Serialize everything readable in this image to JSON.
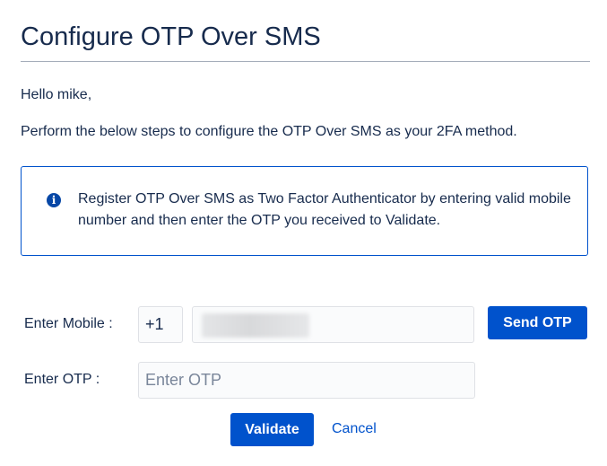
{
  "page": {
    "title": "Configure OTP Over SMS",
    "greeting": "Hello mike,",
    "instructions": "Perform the below steps to configure the OTP Over SMS as your 2FA method."
  },
  "info": {
    "icon": "info-icon",
    "message": "Register OTP Over SMS as Two Factor Authenticator by entering valid mobile number and then enter the OTP you received to Validate."
  },
  "form": {
    "mobile_label": "Enter Mobile :",
    "country_code": "+1",
    "otp_label": "Enter OTP :",
    "otp_placeholder": "Enter OTP",
    "send_otp_label": "Send OTP",
    "validate_label": "Validate",
    "cancel_label": "Cancel"
  },
  "colors": {
    "accent": "#0052cc",
    "text": "#172b4d",
    "info_border": "#0052cc",
    "divider": "#a5adba"
  }
}
